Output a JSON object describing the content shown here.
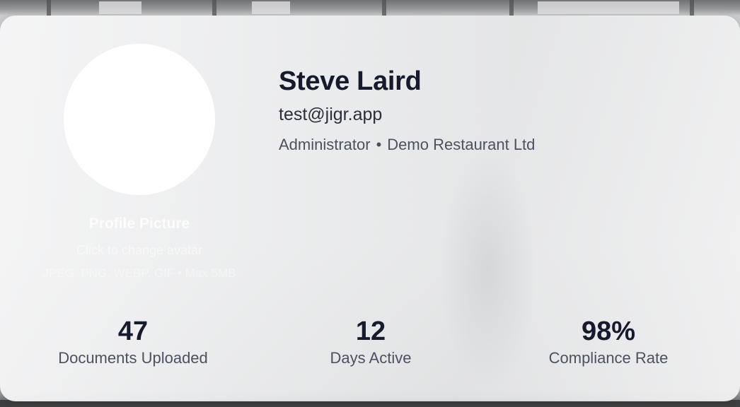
{
  "profile": {
    "name": "Steve Laird",
    "email": "test@jigr.app",
    "role": "Administrator",
    "separator": "•",
    "organization": "Demo Restaurant Ltd"
  },
  "avatar": {
    "title": "Profile Picture",
    "hint": "Click to change avatar",
    "formats": "JPEG, PNG, WEBP, GIF • Max 5MB"
  },
  "stats": [
    {
      "value": "47",
      "label": "Documents Uploaded"
    },
    {
      "value": "12",
      "label": "Days Active"
    },
    {
      "value": "98%",
      "label": "Compliance Rate"
    }
  ],
  "colors": {
    "text_primary": "#151a2d",
    "text_secondary": "#4b5160",
    "card_background": "#f2f2f3"
  }
}
